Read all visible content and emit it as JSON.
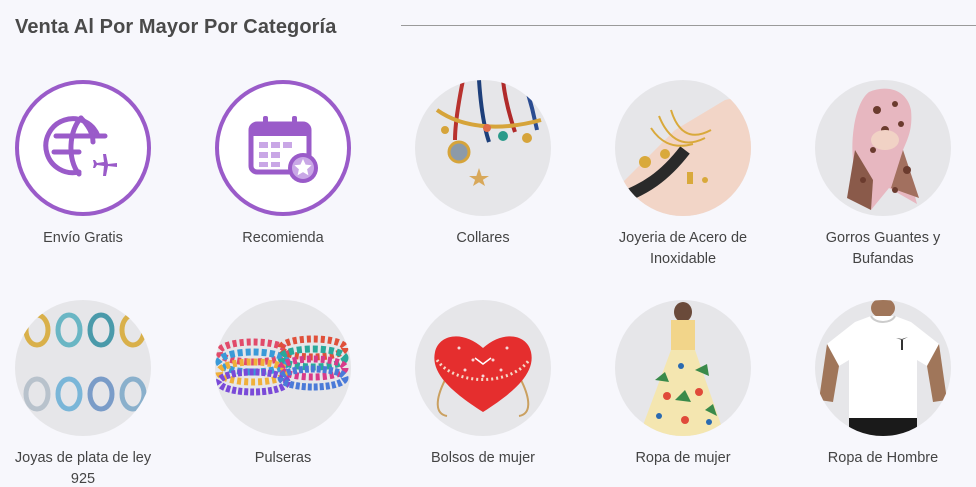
{
  "header": {
    "title": "Venta Al Por Mayor Por Categoría"
  },
  "categories": [
    {
      "label": "Envío Gratis",
      "icon": "globe-plane-icon"
    },
    {
      "label": "Recomienda",
      "icon": "calendar-star-icon"
    },
    {
      "label": "Collares",
      "icon": "necklaces-image"
    },
    {
      "label": "Joyeria de Acero de Inoxidable",
      "icon": "bracelets-hand-image"
    },
    {
      "label": "Gorros Guantes y Bufandas",
      "icon": "scarf-image"
    },
    {
      "label": "Joyas de plata de ley 925",
      "icon": "hoop-earrings-image"
    },
    {
      "label": "Pulseras",
      "icon": "beaded-bracelets-image"
    },
    {
      "label": "Bolsos de mujer",
      "icon": "heart-bag-image"
    },
    {
      "label": "Ropa de mujer",
      "icon": "dress-image"
    },
    {
      "label": "Ropa de Hombre",
      "icon": "tshirt-image"
    }
  ],
  "colors": {
    "accent": "#9a5bc9",
    "background": "#f7f7fc",
    "circle_bg": "#e6e6e9"
  }
}
